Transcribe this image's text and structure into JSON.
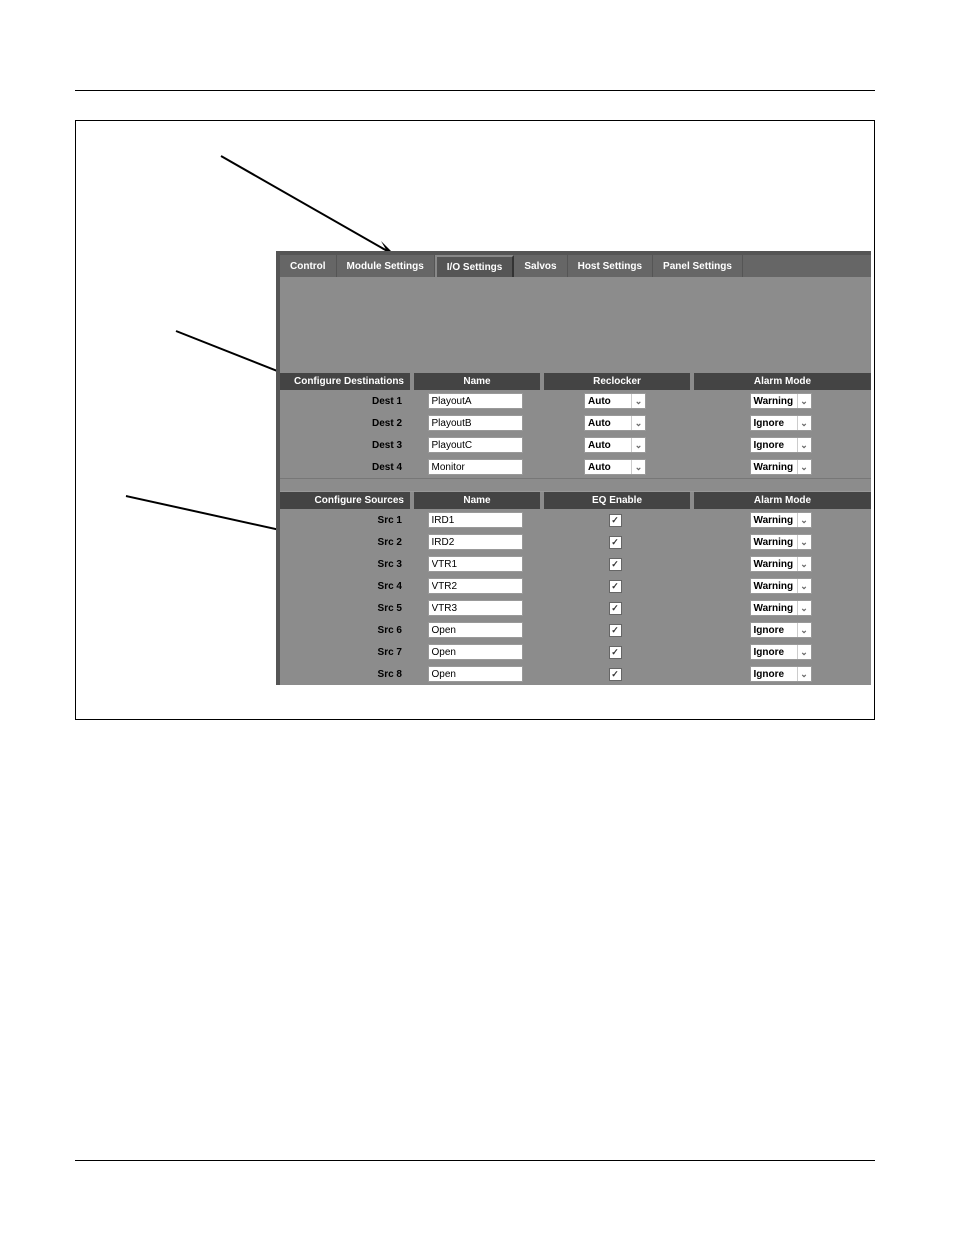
{
  "tabs": {
    "control": "Control",
    "module": "Module Settings",
    "io": "I/O Settings",
    "salvos": "Salvos",
    "host": "Host Settings",
    "panel": "Panel Settings"
  },
  "destinations": {
    "section": "Configure Destinations",
    "col_name": "Name",
    "col_mid": "Reclocker",
    "col_alarm": "Alarm Mode",
    "rows": [
      {
        "label": "Dest 1",
        "name": "PlayoutA",
        "mid": "Auto",
        "alarm": "Warning"
      },
      {
        "label": "Dest 2",
        "name": "PlayoutB",
        "mid": "Auto",
        "alarm": "Ignore"
      },
      {
        "label": "Dest 3",
        "name": "PlayoutC",
        "mid": "Auto",
        "alarm": "Ignore"
      },
      {
        "label": "Dest 4",
        "name": "Monitor",
        "mid": "Auto",
        "alarm": "Warning"
      }
    ]
  },
  "sources": {
    "section": "Configure Sources",
    "col_name": "Name",
    "col_mid": "EQ Enable",
    "col_alarm": "Alarm Mode",
    "rows": [
      {
        "label": "Src 1",
        "name": "IRD1",
        "chk": true,
        "alarm": "Warning"
      },
      {
        "label": "Src 2",
        "name": "IRD2",
        "chk": true,
        "alarm": "Warning"
      },
      {
        "label": "Src 3",
        "name": "VTR1",
        "chk": true,
        "alarm": "Warning"
      },
      {
        "label": "Src 4",
        "name": "VTR2",
        "chk": true,
        "alarm": "Warning"
      },
      {
        "label": "Src 5",
        "name": "VTR3",
        "chk": true,
        "alarm": "Warning"
      },
      {
        "label": "Src 6",
        "name": "Open",
        "chk": true,
        "alarm": "Ignore"
      },
      {
        "label": "Src 7",
        "name": "Open",
        "chk": true,
        "alarm": "Ignore"
      },
      {
        "label": "Src 8",
        "name": "Open",
        "chk": true,
        "alarm": "Ignore"
      }
    ]
  }
}
